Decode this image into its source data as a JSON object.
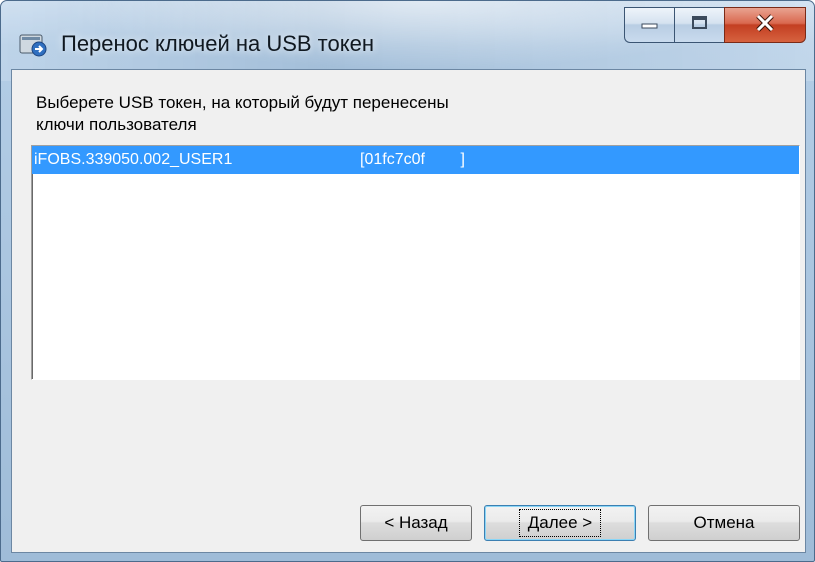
{
  "window": {
    "title": "Перенос ключей на USB токен",
    "icon": "key-transfer-icon"
  },
  "caption_buttons": {
    "minimize_icon": "minimize-icon",
    "maximize_icon": "maximize-icon",
    "close_icon": "close-icon",
    "close_label": "X"
  },
  "instruction": {
    "line1": "Выберете USB токен, на который будут перенесены",
    "line2": "ключи пользователя"
  },
  "tokens": [
    {
      "name": "iFOBS.339050.002_USER1",
      "id": "[01fc7c0f        ]",
      "selected": true
    }
  ],
  "buttons": {
    "back": "< Назад",
    "next": "Далее >",
    "cancel": "Отмена"
  },
  "colors": {
    "selection": "#3399ff",
    "close_button": "#c33f22",
    "dialog_bg": "#f0f0f0"
  }
}
